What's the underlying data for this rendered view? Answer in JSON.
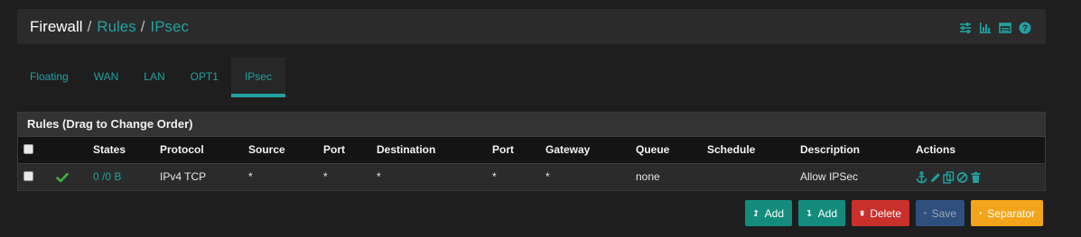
{
  "breadcrumb": {
    "root": "Firewall",
    "sep": "/",
    "item1": "Rules",
    "item2": "IPsec"
  },
  "header_icons": [
    "sliders-icon",
    "bar-chart-icon",
    "table-icon",
    "help-icon"
  ],
  "tabs": [
    {
      "label": "Floating"
    },
    {
      "label": "WAN"
    },
    {
      "label": "LAN"
    },
    {
      "label": "OPT1"
    },
    {
      "label": "IPsec",
      "active": true
    }
  ],
  "panel": {
    "title": "Rules (Drag to Change Order)"
  },
  "table": {
    "columns": [
      "States",
      "Protocol",
      "Source",
      "Port",
      "Destination",
      "Port",
      "Gateway",
      "Queue",
      "Schedule",
      "Description",
      "Actions"
    ],
    "rows": [
      {
        "states": "0 /0 B",
        "protocol": "IPv4 TCP",
        "source": "*",
        "source_port": "*",
        "destination": "*",
        "destination_port": "*",
        "gateway": "*",
        "queue": "none",
        "schedule": "",
        "description": "Allow IPSec"
      }
    ]
  },
  "buttons": {
    "add_top": "Add",
    "add_bottom": "Add",
    "delete": "Delete",
    "save": "Save",
    "separator": "Separator"
  },
  "colors": {
    "accent": "#22a0a0",
    "success": "#3cb043",
    "danger": "#c9302c",
    "warning": "#f2a51a",
    "primary": "#2f4f7f"
  }
}
